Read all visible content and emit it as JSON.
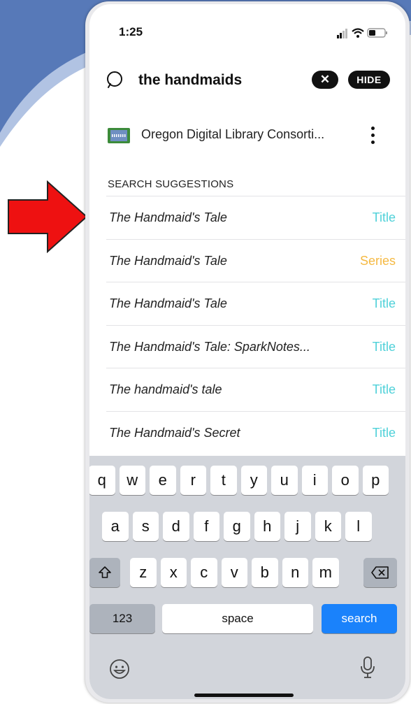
{
  "status": {
    "time": "1:25"
  },
  "search": {
    "value": "the handmaids",
    "clear_label": "✕",
    "hide_label": "HIDE"
  },
  "library": {
    "name": "Oregon Digital Library Consorti..."
  },
  "suggestions": {
    "header": "SEARCH SUGGESTIONS",
    "items": [
      {
        "title": "The Handmaid's Tale",
        "type": "Title"
      },
      {
        "title": "The Handmaid's Tale",
        "type": "Series"
      },
      {
        "title": "The Handmaid's Tale",
        "type": "Title"
      },
      {
        "title": "The Handmaid's Tale: SparkNotes...",
        "type": "Title"
      },
      {
        "title": "The handmaid's tale",
        "type": "Title"
      },
      {
        "title": "The Handmaid's Secret",
        "type": "Title"
      }
    ]
  },
  "keyboard": {
    "row1": [
      "q",
      "w",
      "e",
      "r",
      "t",
      "y",
      "u",
      "i",
      "o",
      "p"
    ],
    "row2": [
      "a",
      "s",
      "d",
      "f",
      "g",
      "h",
      "j",
      "k",
      "l"
    ],
    "row3": [
      "z",
      "x",
      "c",
      "v",
      "b",
      "n",
      "m"
    ],
    "numbers_label": "123",
    "space_label": "space",
    "search_label": "search"
  },
  "colors": {
    "title_type": "#4fd1d9",
    "series_type": "#f5b942",
    "arrow": "#ee1111",
    "search_key": "#1a82fb"
  },
  "icons": {
    "shift": "shift-icon",
    "backspace": "backspace-icon",
    "emoji": "emoji-icon",
    "mic": "microphone-icon"
  }
}
